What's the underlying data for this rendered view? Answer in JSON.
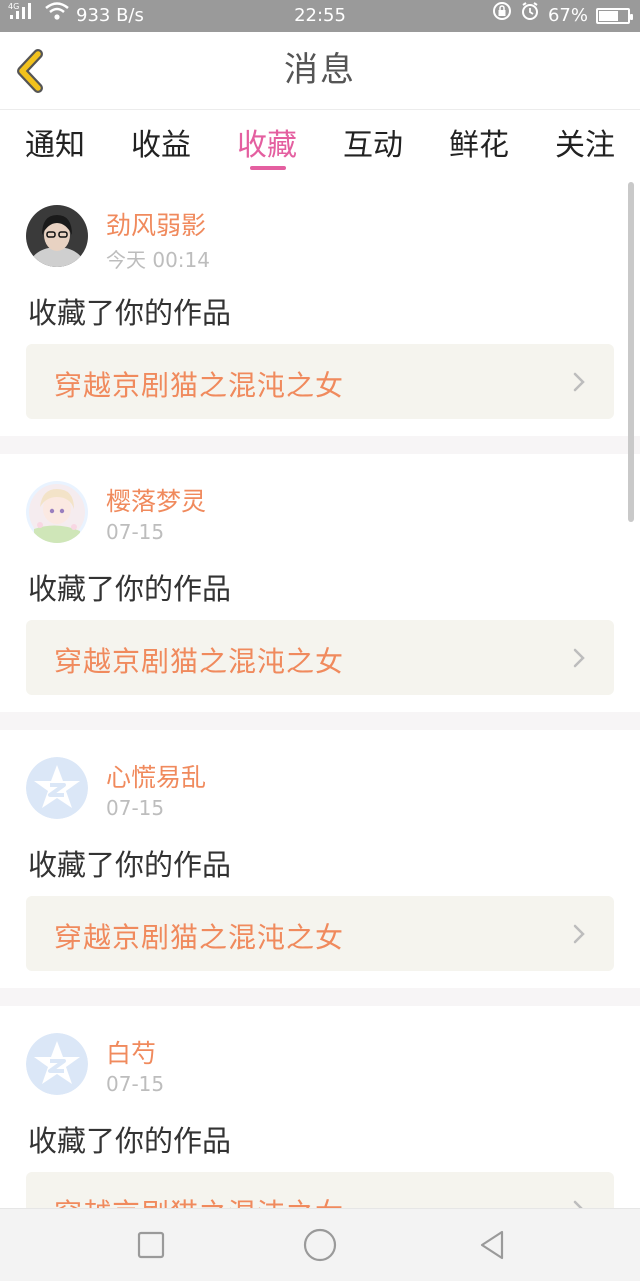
{
  "status_bar": {
    "network": "4G",
    "speed": "933 B/s",
    "time": "22:55",
    "battery_level": "67%",
    "battery_fraction": 0.67
  },
  "header": {
    "title": "消息",
    "back_icon": "back-chevron-icon"
  },
  "tabs": [
    {
      "label": "通知"
    },
    {
      "label": "收益"
    },
    {
      "label": "收藏",
      "active": true
    },
    {
      "label": "互动"
    },
    {
      "label": "鲜花"
    },
    {
      "label": "关注"
    }
  ],
  "messages": [
    {
      "user": "劲风弱影",
      "time": "今天 00:14",
      "action": "收藏了你的作品",
      "work_title": "穿越京剧猫之混沌之女",
      "avatar": "photo"
    },
    {
      "user": "樱落梦灵",
      "time": "07-15",
      "action": "收藏了你的作品",
      "work_title": "穿越京剧猫之混沌之女",
      "avatar": "anime"
    },
    {
      "user": "心慌易乱",
      "time": "07-15",
      "action": "收藏了你的作品",
      "work_title": "穿越京剧猫之混沌之女",
      "avatar": "default"
    },
    {
      "user": "白芍",
      "time": "07-15",
      "action": "收藏了你的作品",
      "work_title": "穿越京剧猫之混沌之女",
      "avatar": "default"
    }
  ],
  "colors": {
    "accent": "#e45fa0",
    "username": "#f08a5d",
    "back_icon": "#f2c21d"
  }
}
